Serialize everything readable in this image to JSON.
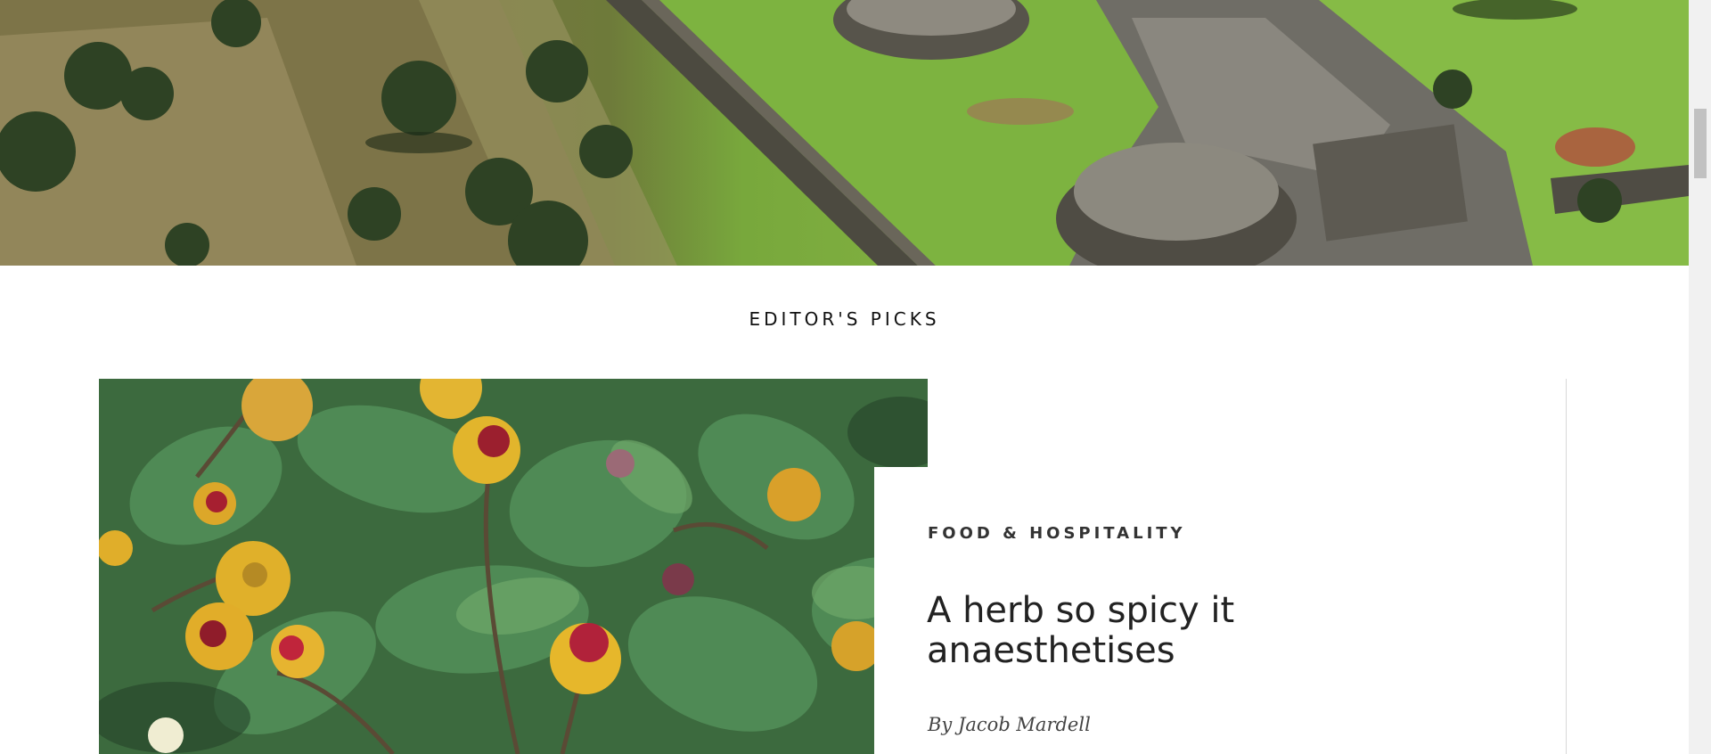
{
  "hero": {
    "image": "aerial-ruins-photo"
  },
  "section": {
    "title": "EDITOR'S PICKS"
  },
  "card": {
    "image": "spilanthes-flowers-photo",
    "category": "FOOD & HOSPITALITY",
    "title": "A herb so spicy it anaesthetises",
    "byline": "By Jacob Mardell"
  },
  "colors": {
    "text": "#222222",
    "divider": "#d9d9d9",
    "scrollbar_track": "#f1f1f1",
    "scrollbar_thumb": "#c1c1c1"
  }
}
